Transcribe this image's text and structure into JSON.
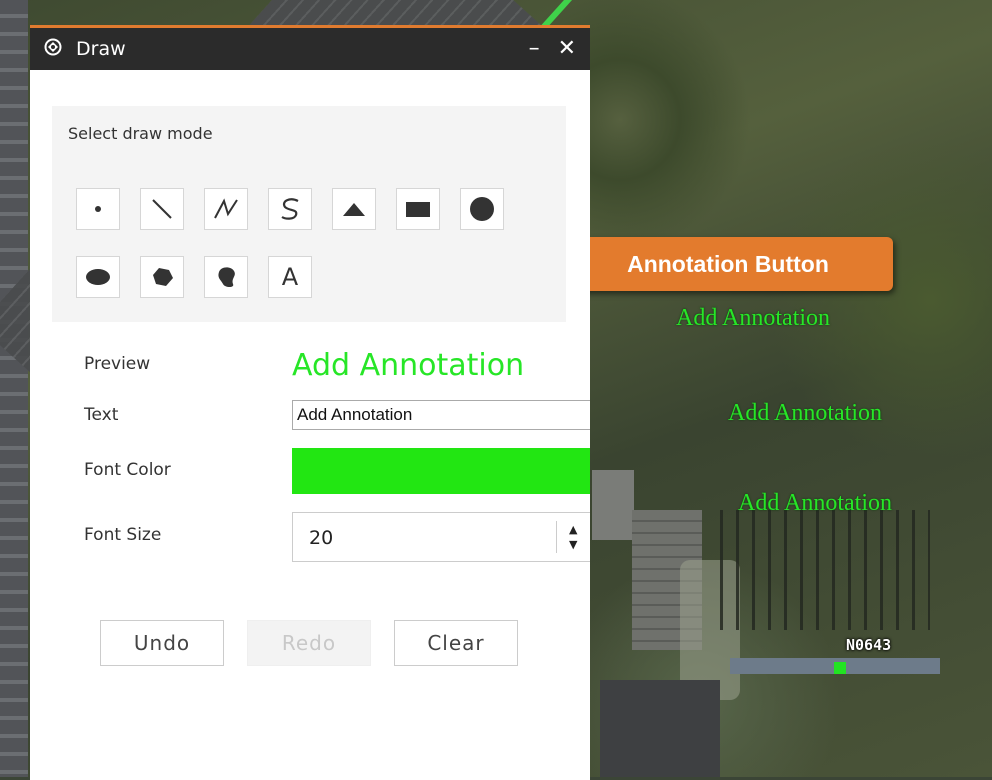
{
  "panel": {
    "title": "Draw",
    "minimize_glyph": "–",
    "close_glyph": "✕",
    "accent_color": "#e07b2f"
  },
  "mode": {
    "label": "Select draw mode",
    "tools": [
      {
        "name": "point"
      },
      {
        "name": "line"
      },
      {
        "name": "polyline"
      },
      {
        "name": "freehand-polyline"
      },
      {
        "name": "triangle"
      },
      {
        "name": "rectangle"
      },
      {
        "name": "circle"
      },
      {
        "name": "ellipse"
      },
      {
        "name": "polygon"
      },
      {
        "name": "freehand-polygon"
      },
      {
        "name": "text",
        "glyph": "A"
      }
    ]
  },
  "form": {
    "preview_label": "Preview",
    "preview_text": "Add Annotation",
    "text_label": "Text",
    "text_value": "Add Annotation",
    "font_color_label": "Font Color",
    "font_color": "#22e612",
    "font_size_label": "Font Size",
    "font_size": "20",
    "spin_up": "▲",
    "spin_down": "▼"
  },
  "actions": {
    "undo": "Undo",
    "redo": "Redo",
    "clear": "Clear"
  },
  "callout": {
    "text": "Annotation Button",
    "color": "#e37b2d"
  },
  "map": {
    "annotations": [
      "Add Annotation",
      "Add Annotation",
      "Add Annotation"
    ],
    "label": "N0643",
    "annotation_color": "#27e627"
  }
}
